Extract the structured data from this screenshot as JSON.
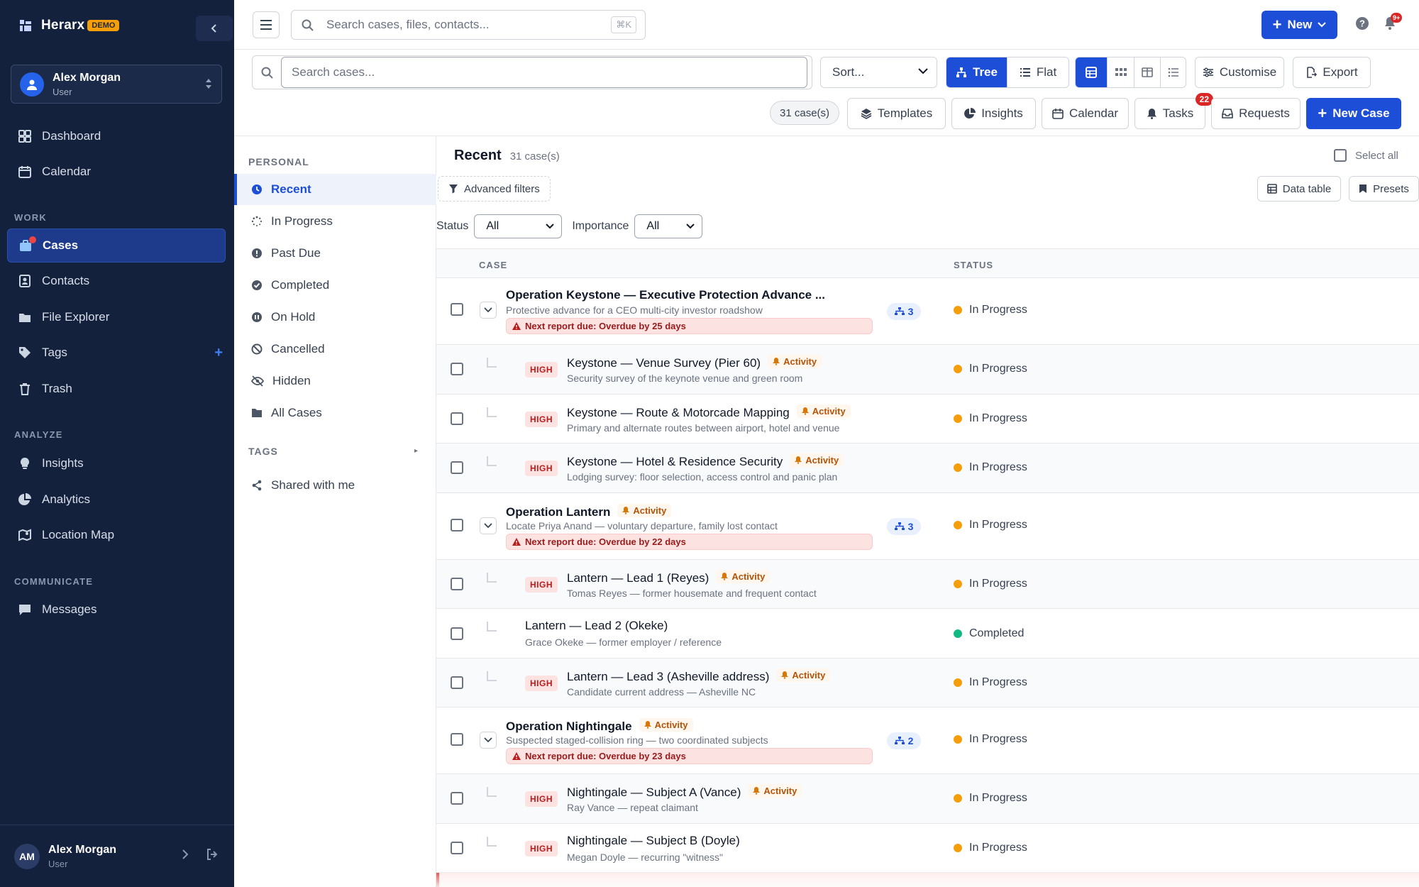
{
  "brand": {
    "name": "Herarx",
    "badge": "DEMO"
  },
  "user": {
    "name": "Alex Morgan",
    "role": "User",
    "initials": "AM"
  },
  "nav": {
    "dashboard": "Dashboard",
    "calendar": "Calendar",
    "work_label": "WORK",
    "cases": "Cases",
    "contacts": "Contacts",
    "file_explorer": "File Explorer",
    "tags": "Tags",
    "trash": "Trash",
    "analyze_label": "ANALYZE",
    "insights": "Insights",
    "analytics": "Analytics",
    "location_map": "Location Map",
    "communicate_label": "COMMUNICATE",
    "messages": "Messages"
  },
  "topbar": {
    "search_placeholder": "Search cases, files, contacts...",
    "shortcut": "⌘K",
    "new_label": "New",
    "notif_badge": "9+"
  },
  "toolbar": {
    "case_search_placeholder": "Search cases...",
    "sort_label": "Sort...",
    "tree_label": "Tree",
    "flat_label": "Flat",
    "customise_label": "Customise",
    "export_label": "Export",
    "case_count": "31 case(s)",
    "templates_label": "Templates",
    "insights_label": "Insights",
    "calendar_label": "Calendar",
    "tasks_label": "Tasks",
    "tasks_badge": "22",
    "requests_label": "Requests",
    "new_case_label": "New Case"
  },
  "subnav": {
    "personal_label": "PERSONAL",
    "recent": "Recent",
    "in_progress": "In Progress",
    "past_due": "Past Due",
    "completed": "Completed",
    "on_hold": "On Hold",
    "cancelled": "Cancelled",
    "hidden": "Hidden",
    "all_cases": "All Cases",
    "tags_label": "TAGS",
    "shared": "Shared with me"
  },
  "list": {
    "title": "Recent",
    "count": "31 case(s)",
    "select_all": "Select all",
    "advanced_filters": "Advanced filters",
    "data_table": "Data table",
    "presets": "Presets",
    "status_label": "Status",
    "status_value": "All",
    "importance_label": "Importance",
    "importance_value": "All",
    "col_case": "CASE",
    "col_status": "STATUS"
  },
  "colors": {
    "in_progress": "#f59e0b",
    "completed": "#10b981",
    "accent": "#1d4ed8",
    "sidebar": "#14213d"
  },
  "rows": [
    {
      "title": "Operation Keystone — Executive Protection Advance ...",
      "sub": "Protective advance for a CEO multi-city investor roadshow",
      "overdue": "Next report due: Overdue by 25 days",
      "children": "3",
      "status": "In Progress"
    },
    {
      "title": "Keystone — Venue Survey (Pier 60)",
      "sub": "Security survey of the keynote venue and green room",
      "prio": "HIGH",
      "activity": "Activity",
      "status": "In Progress"
    },
    {
      "title": "Keystone — Route & Motorcade Mapping",
      "sub": "Primary and alternate routes between airport, hotel and venue",
      "prio": "HIGH",
      "activity": "Activity",
      "status": "In Progress"
    },
    {
      "title": "Keystone — Hotel & Residence Security",
      "sub": "Lodging survey: floor selection, access control and panic plan",
      "prio": "HIGH",
      "activity": "Activity",
      "status": "In Progress"
    },
    {
      "title": "Operation Lantern",
      "sub": "Locate Priya Anand — voluntary departure, family lost contact",
      "activity": "Activity",
      "overdue": "Next report due: Overdue by 22 days",
      "children": "3",
      "status": "In Progress"
    },
    {
      "title": "Lantern — Lead 1 (Reyes)",
      "sub": "Tomas Reyes — former housemate and frequent contact",
      "prio": "HIGH",
      "activity": "Activity",
      "status": "In Progress"
    },
    {
      "title": "Lantern — Lead 2 (Okeke)",
      "sub": "Grace Okeke — former employer / reference",
      "status": "Completed"
    },
    {
      "title": "Lantern — Lead 3 (Asheville address)",
      "sub": "Candidate current address — Asheville NC",
      "prio": "HIGH",
      "activity": "Activity",
      "status": "In Progress"
    },
    {
      "title": "Operation Nightingale",
      "sub": "Suspected staged-collision ring — two coordinated subjects",
      "activity": "Activity",
      "overdue": "Next report due: Overdue by 23 days",
      "children": "2",
      "status": "In Progress"
    },
    {
      "title": "Nightingale — Subject A (Vance)",
      "sub": "Ray Vance — repeat claimant",
      "prio": "HIGH",
      "activity": "Activity",
      "status": "In Progress"
    },
    {
      "title": "Nightingale — Subject B (Doyle)",
      "sub": "Megan Doyle — recurring \"witness\"",
      "prio": "HIGH",
      "status": "In Progress"
    }
  ]
}
